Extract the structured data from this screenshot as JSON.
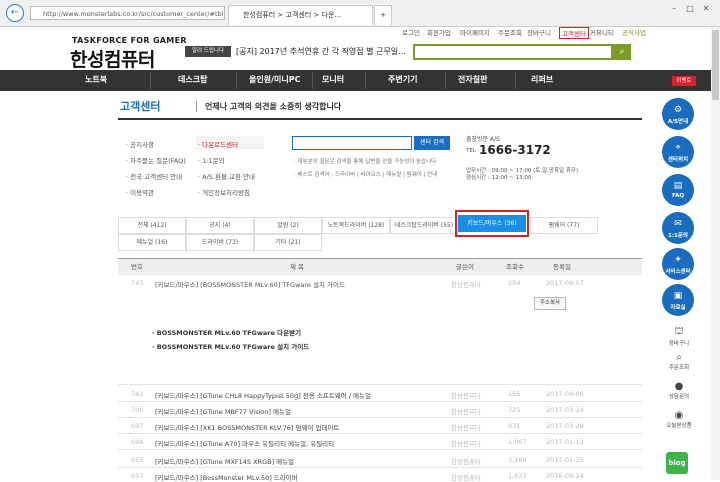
{
  "browser": {
    "url": "http://www.monsterlabs.co.kr/src/customer_center/#tbl_cc_d",
    "tabs": [
      "한성컴퓨터 > 고객센터 > 다운...",
      ""
    ]
  },
  "top_links": [
    "로그인",
    "회원가입",
    "마이페이지",
    "주문조회",
    "장바구니",
    "고객센터",
    "커뮤니티",
    "공식사업"
  ],
  "logo": {
    "line1": "TASKFORCE FOR GAMER",
    "line2": "한성컴퓨터"
  },
  "notice": {
    "tag": "알려 드립니다",
    "text": "[공지] 2017년 추석연휴 간 각 직영점 별 근무일..."
  },
  "nav": {
    "items": [
      "노트북",
      "데스크탑",
      "올인원/미니PC",
      "모니터",
      "주변기기",
      "전자칠판",
      "리퍼브"
    ],
    "event": "이벤트"
  },
  "page": {
    "title": "고객센터",
    "subtitle": "언제나 고객의 의견을 소중히 생각합니다"
  },
  "sidebar": {
    "left": [
      "공지사항",
      "자주묻는 질문(FAQ)",
      "전국 고객센터 안내",
      "이용약관"
    ],
    "right": [
      "다운로드센터",
      "1:1문의",
      "A/S,환불,교환 안내",
      "개인정보처리방침"
    ]
  },
  "search_box": {
    "button": "센터 검색",
    "hint1": "대부분의 질문은 검색을 통해 답변을 얻을 가능성이 높습니다",
    "hint2": "베스트 검색어 : 드라이버 | 바이오스 | 매뉴얼 | 펌웨어 | 안내"
  },
  "cs": {
    "label": "출장방문 A/S",
    "tel_label": "TEL",
    "phone": "1666-3172",
    "hours1": "업무시간 : 09:00 ~ 17:00 (토,일,공휴일 휴무)",
    "hours2": "점심시간 : 12:00 ~ 13:00"
  },
  "categories": [
    "전체 (412)",
    "공지 (4)",
    "알림 (2)",
    "노트북드라이버 (128)",
    "데스크탑드라이버 (55)",
    "키보드/마우스 (36)",
    "펌웨어 (77)",
    "메뉴얼 (16)",
    "드라이버 (73)",
    "기타 (21)"
  ],
  "table": {
    "headers": [
      "번호",
      "제 목",
      "글쓴이",
      "조회수",
      "등록일"
    ],
    "expanded": {
      "no": "743",
      "title": "[키보드/마우스] [BOSSMONSTER MLv.60] TFGware 설치 가이드",
      "author": "한성컴퓨터",
      "views": "294",
      "date": "2017-09-07",
      "copy": "주소복사",
      "body": [
        "· BOSSMONSTER MLv.60 TFGware 다운받기",
        "· BOSSMONSTER MLv.60 TFGware 설치 가이드"
      ]
    },
    "rows": [
      {
        "no": "742",
        "title": "[키보드/마우스] [GTune CHL8 HappyTypist 50g] 전용 소프트웨어 / 메뉴얼",
        "author": "한성컴퓨터",
        "views": "155",
        "date": "2017-09-06"
      },
      {
        "no": "700",
        "title": "[키보드/마우스] [GTune MBF77 Vision] 메뉴얼",
        "author": "한성컴퓨터",
        "views": "725",
        "date": "2017-03-24"
      },
      {
        "no": "697",
        "title": "[키보드/마우스] [XK1 BOSSMONSTER KLV.76] 펌웨어 업데이트",
        "author": "한성컴퓨터",
        "views": "971",
        "date": "2017-03-29"
      },
      {
        "no": "694",
        "title": "[키보드/마우스] [GTune A70] 마우스 유틸리티 메뉴얼, 유틸리티",
        "author": "한성컴퓨터",
        "views": "1,067",
        "date": "2017-01-12"
      },
      {
        "no": "665",
        "title": "[키보드/마우스] [GTune MXF14S XRGB] 메뉴얼",
        "author": "한성컴퓨터",
        "views": "3,168",
        "date": "2017-01-25"
      },
      {
        "no": "657",
        "title": "[키보드/마우스] [BossMonster MLv.50] 드라이버",
        "author": "한성컴퓨터",
        "views": "1,632",
        "date": "2016-09-24"
      }
    ]
  },
  "quick_menu": {
    "circles": [
      "A/S안내",
      "센터위치",
      "FAQ",
      "1:1문의",
      "서비스센터",
      "자료실"
    ],
    "circle_icons": [
      "gear-icon",
      "pin-icon",
      "book-icon",
      "chat-icon",
      "wrench-icon",
      "folder-icon"
    ],
    "links": [
      "장바구니",
      "주문조회",
      "상담문의",
      "오늘본상품"
    ],
    "blog": "blog"
  },
  "colors": {
    "brand_blue": "#1b6fbf",
    "highlight_red": "#d2232a",
    "selected_tab": "#1b8ee6",
    "nav_bg": "#333333"
  }
}
